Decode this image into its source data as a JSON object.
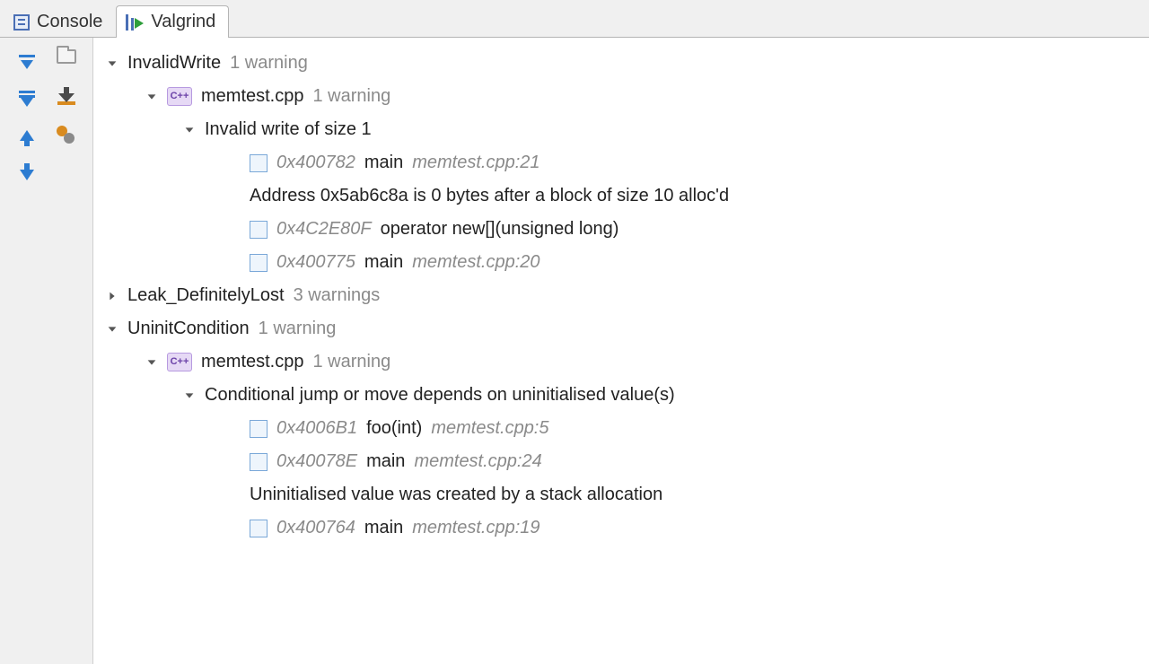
{
  "tabs": {
    "console": "Console",
    "valgrind": "Valgrind",
    "active": "valgrind"
  },
  "gutter_buttons": [
    "expand-all",
    "folder",
    "collapse-all",
    "download",
    "prev-error",
    "settings",
    "next-error"
  ],
  "tree": {
    "cpp_label": "C++",
    "file_label": "memtest.cpp",
    "groups": [
      {
        "name": "InvalidWrite",
        "count_label": "1 warning",
        "expanded": true,
        "file_count_label": "1 warning",
        "messages": [
          {
            "text": "Invalid write of size 1",
            "expanded": true,
            "frames": [
              {
                "addr": "0x400782",
                "func": "main",
                "loc": "memtest.cpp:21"
              }
            ],
            "aux_text": "Address 0x5ab6c8a is 0 bytes after a block of size 10 alloc'd",
            "aux_frames": [
              {
                "addr": "0x4C2E80F",
                "func": "operator new[](unsigned long)",
                "loc": ""
              },
              {
                "addr": "0x400775",
                "func": "main",
                "loc": "memtest.cpp:20"
              }
            ]
          }
        ]
      },
      {
        "name": "Leak_DefinitelyLost",
        "count_label": "3 warnings",
        "expanded": false
      },
      {
        "name": "UninitCondition",
        "count_label": "1 warning",
        "expanded": true,
        "file_count_label": "1 warning",
        "messages": [
          {
            "text": "Conditional jump or move depends on uninitialised value(s)",
            "expanded": true,
            "frames": [
              {
                "addr": "0x4006B1",
                "func": "foo(int)",
                "loc": "memtest.cpp:5"
              },
              {
                "addr": "0x40078E",
                "func": "main",
                "loc": "memtest.cpp:24"
              }
            ],
            "aux_text": "Uninitialised value was created by a stack allocation",
            "aux_frames": [
              {
                "addr": "0x400764",
                "func": "main",
                "loc": "memtest.cpp:19"
              }
            ]
          }
        ]
      }
    ]
  }
}
